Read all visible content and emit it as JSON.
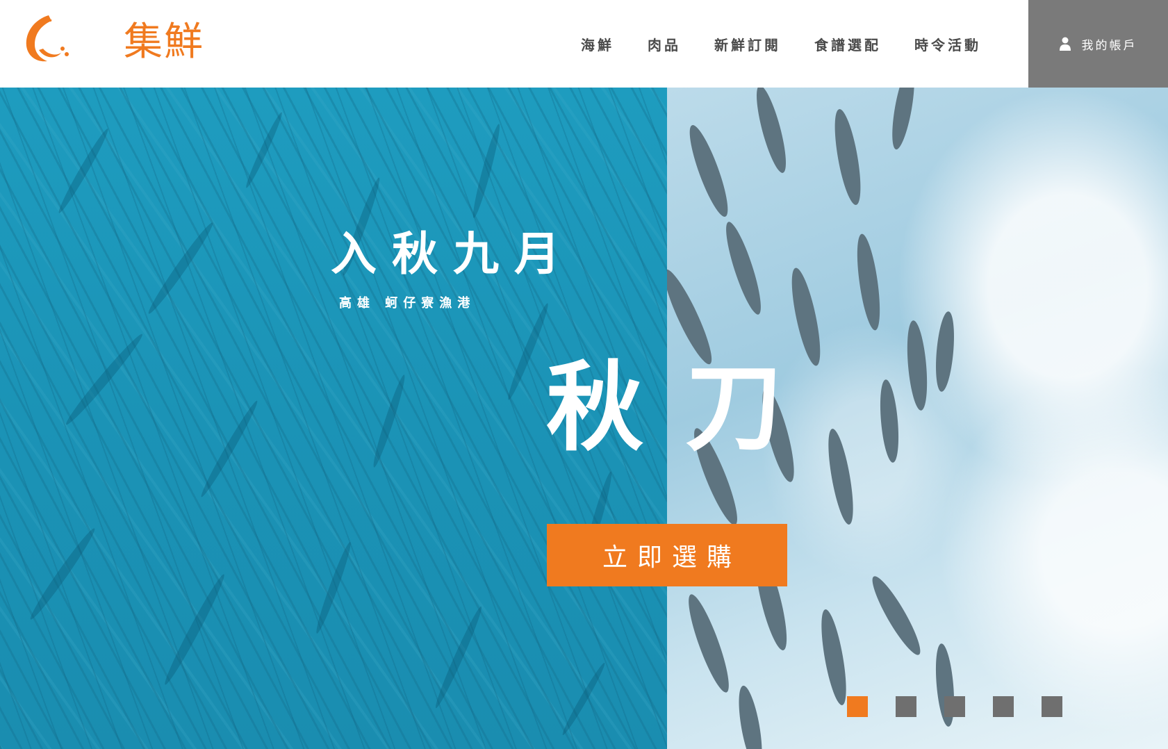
{
  "brand": {
    "name": "集鮮",
    "logo_icon": "shrimp-logo-icon",
    "color": "#f07a1f"
  },
  "nav": {
    "items": [
      {
        "label": "海鮮"
      },
      {
        "label": "肉品"
      },
      {
        "label": "新鮮訂閱"
      },
      {
        "label": "食譜選配"
      },
      {
        "label": "時令活動"
      }
    ]
  },
  "account": {
    "icon": "user-icon",
    "label": "我的帳戶",
    "background": "#7a7a7a"
  },
  "hero": {
    "title": "入秋九月",
    "subtitle": "高雄 蚵仔寮漁港",
    "main": "秋刀",
    "cta_label": "立即選購",
    "cta_color": "#f07a1f",
    "left_color": "#1e9cbf",
    "slides": {
      "count": 5,
      "active_index": 0
    }
  }
}
